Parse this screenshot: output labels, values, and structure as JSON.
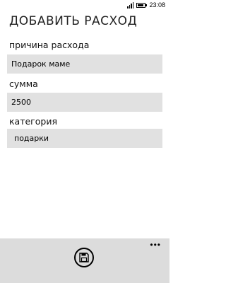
{
  "status_bar": {
    "time": "23:08"
  },
  "page": {
    "title": "ДОБАВИТЬ РАСХОД"
  },
  "form": {
    "reason": {
      "label": "причина расхода",
      "value": "Подарок маме"
    },
    "amount": {
      "label": "сумма",
      "value": "2500"
    },
    "category": {
      "label": "категория",
      "value": "подарки"
    }
  },
  "app_bar": {
    "save_icon": "save-icon",
    "more_icon": "more-icon",
    "background": "#dcdcdc"
  }
}
